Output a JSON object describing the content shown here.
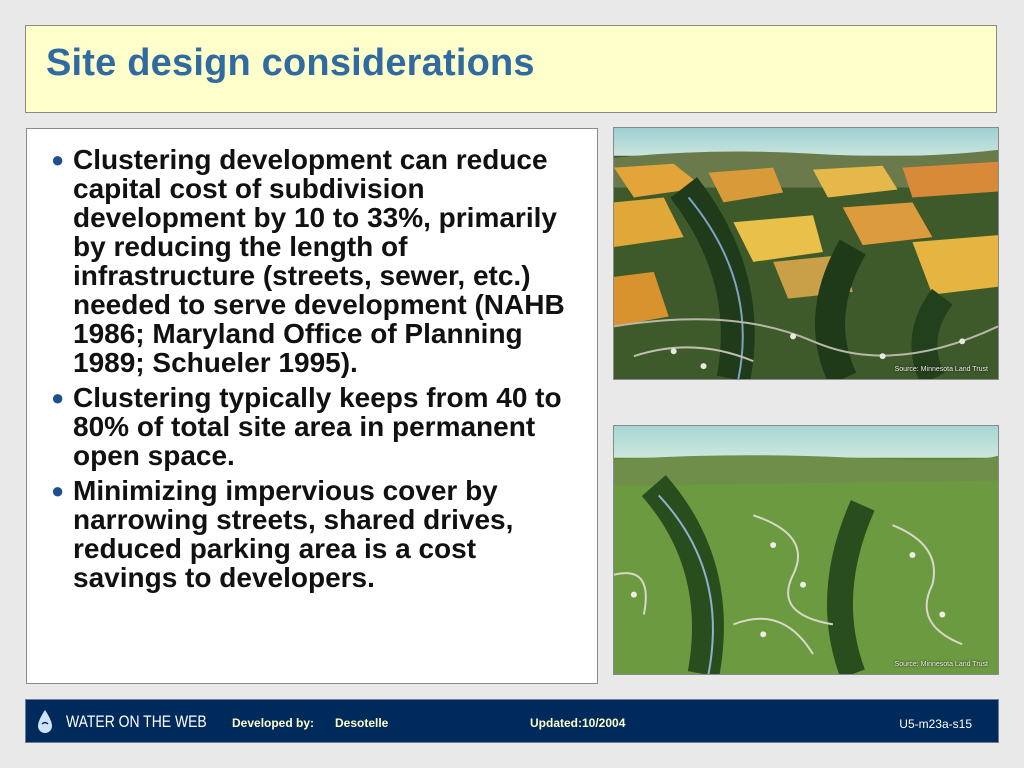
{
  "title": "Site design considerations",
  "bullets": [
    "Clustering development can reduce capital cost of subdivision development by 10 to 33%, primarily by reducing the length of infrastructure (streets, sewer, etc.) needed to serve development (NAHB 1986; Maryland Office of Planning 1989; Schueler 1995).",
    "Clustering typically keeps from 40 to 80% of total site area in permanent open space.",
    "Minimizing impervious cover by narrowing streets, shared drives, reduced parking area is a cost savings to developers."
  ],
  "images": [
    {
      "credit": "Source: Minnesota Land Trust"
    },
    {
      "credit": "Source: Minnesota Land Trust"
    }
  ],
  "footer": {
    "logo_text": "WATER ON THE WEB",
    "developed_by_label": "Developed by:",
    "developer": "Desotelle",
    "updated": "Updated:10/2004",
    "slide_code": "U5-m23a-s15"
  },
  "colors": {
    "title": "#2f6aa0",
    "title_background": "#ffffcc",
    "footer_background": "#002a5c",
    "footer_text": "#ffffcc"
  },
  "icons": [
    "bullet-icon",
    "water-drop-logo-icon"
  ]
}
